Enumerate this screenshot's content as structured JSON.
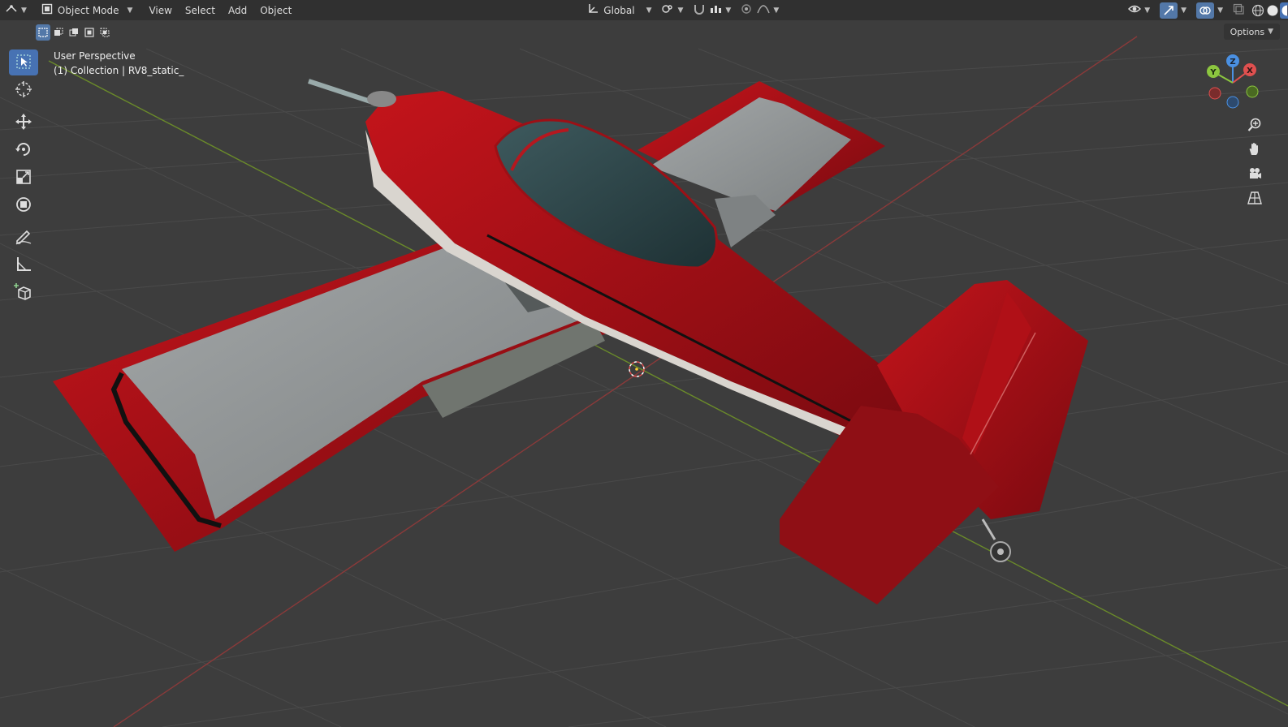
{
  "header": {
    "mode_label": "Object Mode",
    "menus": [
      "View",
      "Select",
      "Add",
      "Object"
    ],
    "transform_orientation": "Global",
    "options_label": "Options"
  },
  "overlay": {
    "view_name": "User Perspective",
    "collection_info": "(1) Collection | RV8_static_"
  },
  "gizmo": {
    "axis_x": "X",
    "axis_y": "Y",
    "axis_z": "Z",
    "color_x": "#e0504f",
    "color_y": "#8cc63f",
    "color_z": "#4a90e2"
  },
  "colors": {
    "accent": "#4772b3",
    "viewport_bg": "#3d3d3d",
    "aircraft_red": "#b8121a",
    "wing_grey": "#8f9394"
  },
  "tools": [
    "select-box",
    "cursor",
    "move",
    "rotate",
    "scale",
    "transform",
    "annotate",
    "measure",
    "add-cube"
  ],
  "nav_buttons": [
    "zoom-icon",
    "hand-pan-icon",
    "camera-icon",
    "grid-ortho-icon"
  ]
}
